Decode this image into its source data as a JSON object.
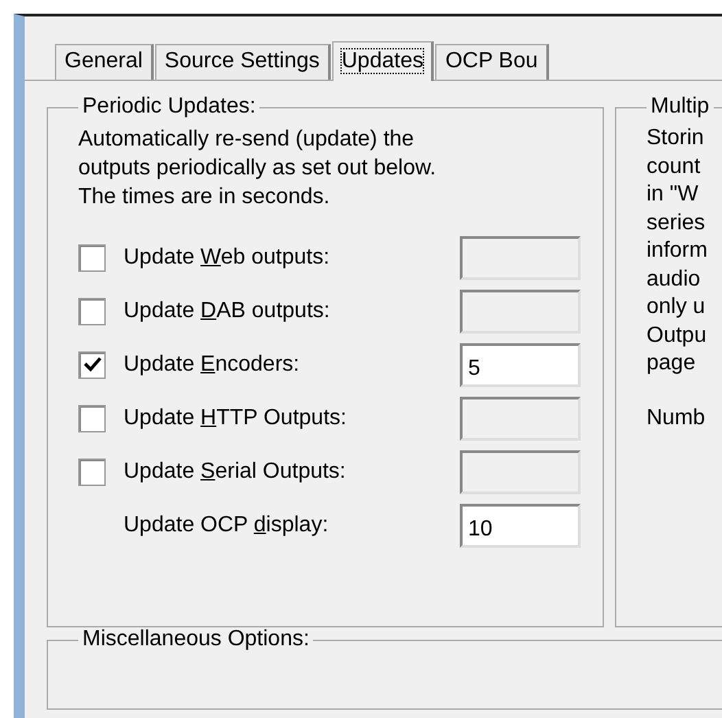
{
  "tabs": [
    {
      "label": "General",
      "selected": false
    },
    {
      "label": "Source Settings",
      "selected": false
    },
    {
      "label": "Updates",
      "selected": true
    },
    {
      "label": "OCP Bou",
      "selected": false
    }
  ],
  "periodic_updates": {
    "title": "Periodic Updates:",
    "description": "Automatically re-send (update) the outputs periodically as set out below. The times are in seconds.",
    "rows": [
      {
        "kind": "checkbox",
        "checked": false,
        "label_pre": "Update ",
        "mnemonic": "W",
        "label_post": "eb outputs:",
        "field_disabled": true
      },
      {
        "kind": "checkbox",
        "checked": false,
        "label_pre": "Update ",
        "mnemonic": "D",
        "label_post": "AB outputs:",
        "field_disabled": true
      },
      {
        "kind": "checkbox",
        "checked": true,
        "label_pre": "Update ",
        "mnemonic": "E",
        "label_post": "ncoders:",
        "field_disabled": false,
        "value": "5"
      },
      {
        "kind": "checkbox",
        "checked": false,
        "label_pre": "Update ",
        "mnemonic": "H",
        "label_post": "TTP Outputs:",
        "field_disabled": true
      },
      {
        "kind": "checkbox",
        "checked": false,
        "label_pre": "Update ",
        "mnemonic": "S",
        "label_post": "erial Outputs:",
        "field_disabled": true
      },
      {
        "kind": "plain",
        "label_pre": "Update OCP ",
        "mnemonic": "d",
        "label_post": "isplay:",
        "field_disabled": false,
        "value": "10"
      }
    ]
  },
  "multiple_group": {
    "title": "Multip",
    "lines": [
      "Storin",
      "count",
      "in \"W",
      "series",
      "inform",
      "audio",
      "only u",
      "Outpu",
      "page"
    ],
    "footer": "Numb"
  },
  "misc_options": {
    "title": "Miscellaneous Options:"
  }
}
